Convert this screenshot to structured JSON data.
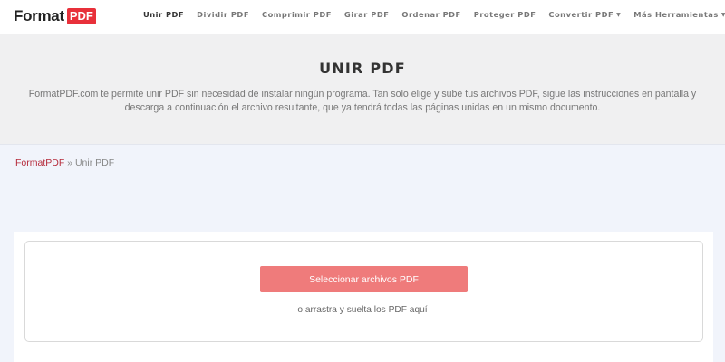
{
  "logo": {
    "text": "Format",
    "badge": "PDF"
  },
  "nav": {
    "items": [
      {
        "label": "Unir PDF",
        "active": true
      },
      {
        "label": "Dividir PDF"
      },
      {
        "label": "Comprimir PDF"
      },
      {
        "label": "Girar PDF"
      },
      {
        "label": "Ordenar PDF"
      },
      {
        "label": "Proteger PDF"
      },
      {
        "label": "Convertir PDF",
        "dropdown": true
      },
      {
        "label": "Más Herramientas",
        "dropdown": true
      }
    ],
    "caret": "▼"
  },
  "hero": {
    "title": "UNIR PDF",
    "description": "FormatPDF.com te permite unir PDF sin necesidad de instalar ningún programa. Tan solo elige y sube tus archivos PDF, sigue las instrucciones en pantalla y descarga a continuación el archivo resultante, que ya tendrá todas las páginas unidas en un mismo documento."
  },
  "breadcrumb": {
    "home": "FormatPDF",
    "separator": " » ",
    "current": "Unir PDF"
  },
  "upload": {
    "button_label": "Seleccionar archivos PDF",
    "hint": "o arrastra y suelta los PDF aquí"
  },
  "colors": {
    "brand_red": "#e8303a",
    "button_red": "#ef7b7b",
    "breadcrumb_link": "#b52a3a"
  }
}
